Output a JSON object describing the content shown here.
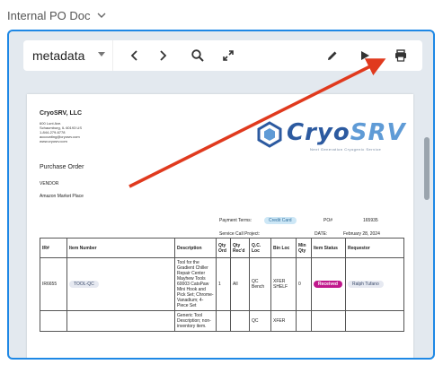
{
  "header": {
    "title": "Internal PO Doc"
  },
  "toolbar": {
    "view_select": "metadata",
    "buttons": [
      "chevron-left",
      "chevron-right",
      "search",
      "expand",
      "edit",
      "play",
      "print"
    ]
  },
  "doc": {
    "company": "CryoSRV, LLC",
    "address": [
      "600 Lunt Ave.",
      "Schaumburg, IL 60193 US",
      "1-844-279-6778",
      "accounting@cryosrv.com",
      "www.cryosrv.com"
    ],
    "logo": {
      "word_a": "Cryo",
      "word_b": "SRV",
      "tagline": "Next Generation Cryogenic Service"
    },
    "po_title": "Purchase Order",
    "vendor_label": "VENDOR",
    "vendor_name": "Amazon Market Place",
    "payment_terms_label": "Payment Terms:",
    "payment_terms_value": "Credit Card",
    "po_label": "PO#",
    "po_value": "165935",
    "service_call_label": "Service Call Project:",
    "date_label": "DATE:",
    "date_value": "February 28, 2024",
    "table": {
      "headers": [
        "IR#",
        "Item Number",
        "Description",
        "Qty Ord",
        "Qty Rec'd",
        "Q.C. Loc",
        "Bin Loc",
        "Min Qty",
        "Item Status",
        "Requestor"
      ],
      "rows": [
        {
          "ir": "IR6655",
          "item": "TOOL-QC",
          "desc": "Tool for the Gradient Chiller Repair Center Mayhew Tools 60003 CatsPaw Mini Hook and Pick Set; Chrome-Vanadium; 4-Piece Set",
          "qty_ord": "1",
          "qty_recd": "All",
          "qc_loc": "QC Bench",
          "bin_loc": "XFER SHELF",
          "min_qty": "0",
          "status": "Received",
          "requestor": "Ralph Tufano"
        },
        {
          "ir": "",
          "item": "",
          "desc": "Generic Tool Description; non-inventory item.",
          "qty_ord": "",
          "qty_recd": "",
          "qc_loc": "QC",
          "bin_loc": "XFER",
          "min_qty": "",
          "status": "",
          "requestor": ""
        }
      ]
    }
  },
  "annotation": {
    "arrow_color": "#e03a1e"
  },
  "colors": {
    "frame_border": "#1e88e5",
    "status_received": "#c0188c"
  }
}
